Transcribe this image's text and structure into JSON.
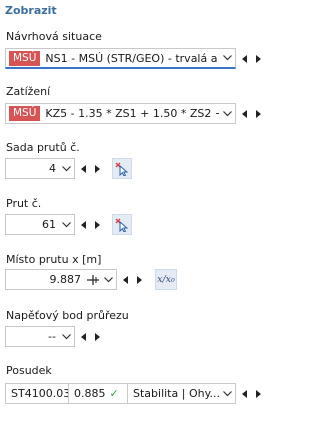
{
  "panel": {
    "title": "Zobrazit"
  },
  "design_situation": {
    "label": "Návrhová situace",
    "tag": "MSÚ",
    "value": "NS1 - MSÚ (STR/GEO) - trvalá a ...",
    "tag_color": "#d65454"
  },
  "load": {
    "label": "Zatížení",
    "tag": "MSÚ",
    "value": "KZ5 - 1.35 * ZS1 + 1.50 * ZS2 + 0...."
  },
  "member_set": {
    "label": "Sada prutů č.",
    "value": "4"
  },
  "member": {
    "label": "Prut č.",
    "value": "61"
  },
  "location": {
    "label": "Místo prutu x [m]",
    "value": "9.887",
    "relative_button": "x/x₀"
  },
  "stress_point": {
    "label": "Napěťový bod průřezu",
    "value": "--"
  },
  "check": {
    "label": "Posudek",
    "id": "ST4100.03",
    "ratio": "0.885",
    "ratio_status": "ok",
    "type": "Stabilita | Ohy..."
  },
  "icons": {
    "dropdown": "chevron-down-icon",
    "prev": "triangle-left-icon",
    "next": "triangle-right-icon",
    "pick": "select-cursor-icon",
    "ok": "check-icon",
    "location_marker": "member-location-icon"
  },
  "colors": {
    "accent": "#3b73c4",
    "title": "#3c6e9f",
    "tag": "#d65454",
    "ok": "#2f9e44"
  }
}
